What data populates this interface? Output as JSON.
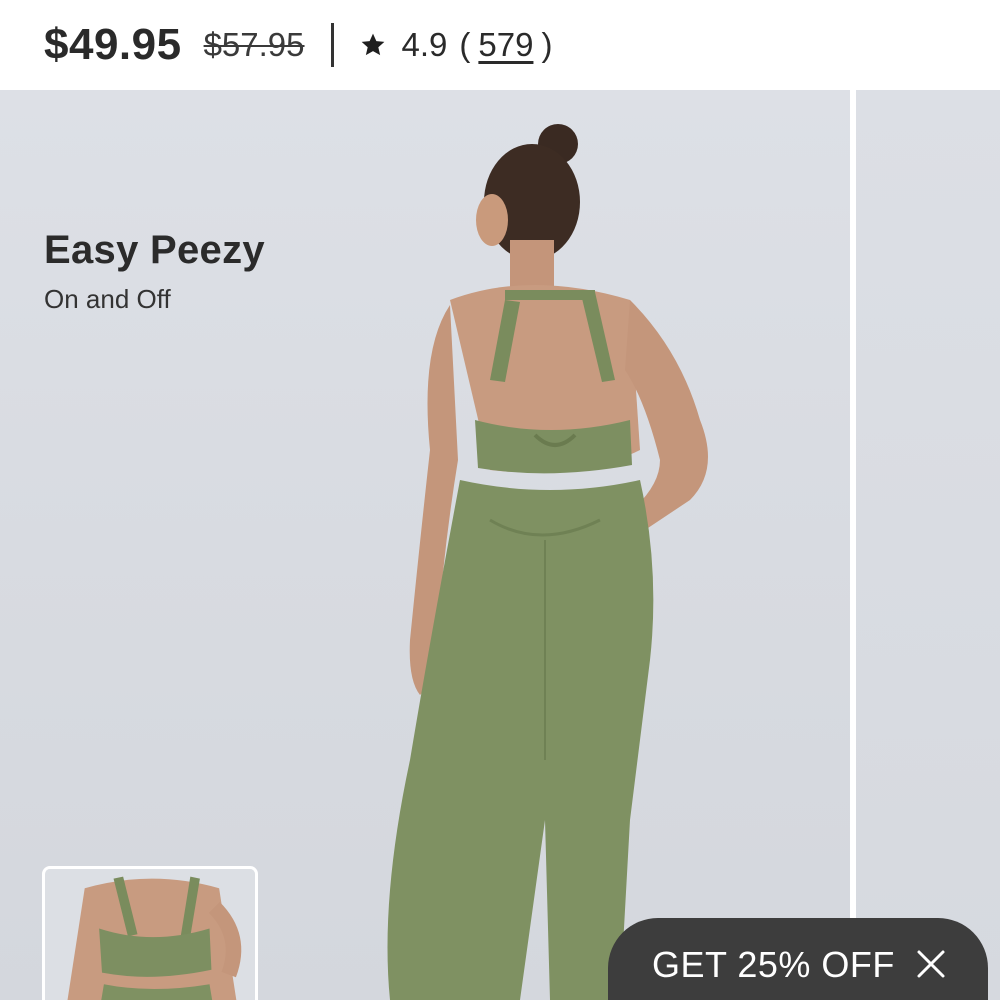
{
  "header": {
    "price": "$49.95",
    "original_price": "$57.95",
    "rating": "4.9",
    "paren_open": "(",
    "review_count": "579",
    "paren_close": ")",
    "star_icon": "star-icon"
  },
  "product": {
    "title": "Easy Peezy",
    "subtitle": "On and Off",
    "color": "#7f9162"
  },
  "promo": {
    "label": "GET 25% OFF",
    "close_icon": "close-icon"
  }
}
